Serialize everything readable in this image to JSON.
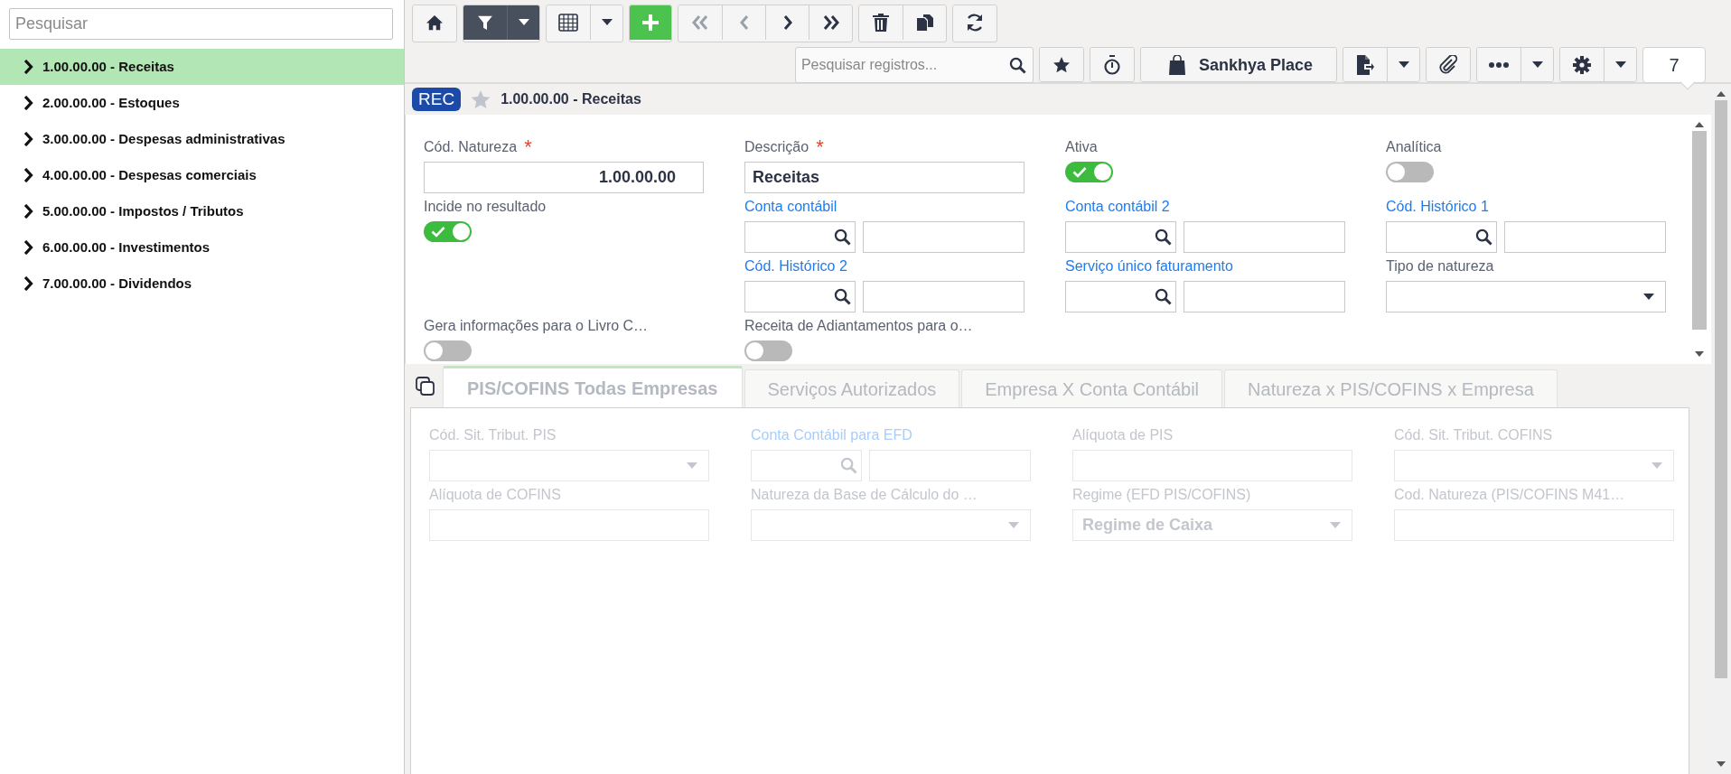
{
  "sidebar": {
    "search": {
      "placeholder": "Pesquisar"
    },
    "items": [
      {
        "label": "1.00.00.00 - Receitas",
        "selected": true
      },
      {
        "label": "2.00.00.00 - Estoques",
        "selected": false
      },
      {
        "label": "3.00.00.00 - Despesas administrativas",
        "selected": false
      },
      {
        "label": "4.00.00.00 - Despesas comerciais",
        "selected": false
      },
      {
        "label": "5.00.00.00 - Impostos / Tributos",
        "selected": false
      },
      {
        "label": "6.00.00.00 - Investimentos",
        "selected": false
      },
      {
        "label": "7.00.00.00 - Dividendos",
        "selected": false
      }
    ]
  },
  "toolbar": {
    "groups": [
      [
        {
          "kind": "home",
          "active": false,
          "disabled": false
        }
      ],
      [
        {
          "kind": "filter",
          "active": true,
          "disabled": false
        },
        {
          "kind": "caret",
          "active": true,
          "disabled": false
        }
      ],
      [
        {
          "kind": "grid",
          "active": false,
          "disabled": false
        },
        {
          "kind": "caret",
          "active": false,
          "disabled": false
        }
      ],
      [
        {
          "kind": "add",
          "active": false,
          "disabled": false
        }
      ],
      [
        {
          "kind": "first",
          "active": false,
          "disabled": true
        },
        {
          "kind": "previous",
          "active": false,
          "disabled": true
        },
        {
          "kind": "next",
          "active": false,
          "disabled": false
        },
        {
          "kind": "last",
          "active": false,
          "disabled": false
        }
      ],
      [
        {
          "kind": "delete",
          "active": false,
          "disabled": false
        },
        {
          "kind": "duplicate",
          "active": false,
          "disabled": false
        }
      ],
      [
        {
          "kind": "refresh",
          "active": false,
          "disabled": false
        }
      ]
    ],
    "search": {
      "placeholder": "Pesquisar registros..."
    },
    "actions": [
      [
        {
          "kind": "favorite"
        }
      ],
      [
        {
          "kind": "timer"
        }
      ],
      [
        {
          "kind": "place",
          "label": "Sankhya Place"
        }
      ],
      [
        {
          "kind": "export"
        },
        {
          "kind": "caret"
        }
      ],
      [
        {
          "kind": "attach"
        }
      ],
      [
        {
          "kind": "more"
        },
        {
          "kind": "caret"
        }
      ],
      [
        {
          "kind": "settings"
        },
        {
          "kind": "caret"
        }
      ]
    ],
    "count": "7"
  },
  "record": {
    "badge": "REC",
    "favorite": false,
    "title": "1.00.00.00 - Receitas"
  },
  "form": {
    "rows": [
      [
        {
          "kind": "text",
          "label": "Cód. Natureza",
          "required_mark": "*",
          "link": false,
          "value": "1.00.00.00",
          "right_aligned": true
        },
        {
          "kind": "text",
          "label": "Descrição",
          "required_mark": "*",
          "link": false,
          "value": "Receitas",
          "right_aligned": false
        },
        {
          "kind": "toggle",
          "label": "Ativa",
          "link": false,
          "on": true
        },
        {
          "kind": "toggle",
          "label": "Analítica",
          "link": false,
          "on": false
        }
      ],
      [
        {
          "kind": "toggle",
          "label": "Incide no resultado",
          "link": false,
          "on": true
        },
        {
          "kind": "lookup",
          "label": "Conta contábil",
          "link": true
        },
        {
          "kind": "lookup",
          "label": "Conta contábil 2",
          "link": true
        },
        {
          "kind": "lookup",
          "label": "Cód. Histórico 1",
          "link": true
        }
      ],
      [
        {
          "kind": "blank"
        },
        {
          "kind": "lookup",
          "label": "Cód. Histórico 2",
          "link": true
        },
        {
          "kind": "lookup",
          "label": "Serviço único faturamento",
          "link": true
        },
        {
          "kind": "select",
          "label": "Tipo de natureza",
          "link": false
        }
      ],
      [
        {
          "kind": "toggle",
          "label": "Gera informações para o Livro C…",
          "link": false,
          "on": false
        },
        {
          "kind": "toggle",
          "label": "Receita de Adiantamentos para o…",
          "link": false,
          "on": false
        }
      ]
    ]
  },
  "tabs": [
    {
      "label": "PIS/COFINS Todas Empresas",
      "selected": true
    },
    {
      "label": "Serviços Autorizados",
      "selected": false
    },
    {
      "label": "Empresa X Conta Contábil",
      "selected": false
    },
    {
      "label": "Natureza x PIS/COFINS x Empresa",
      "selected": false
    }
  ],
  "tab_panel": {
    "disabled": true,
    "rows": [
      [
        {
          "kind": "select",
          "label": "Cód. Sit. Tribut. PIS",
          "link": false
        },
        {
          "kind": "lookup",
          "label": "Conta Contábil para EFD",
          "link": true
        },
        {
          "kind": "text",
          "label": "Alíquota de PIS",
          "link": false
        },
        {
          "kind": "select",
          "label": "Cód. Sit. Tribut. COFINS",
          "link": false
        }
      ],
      [
        {
          "kind": "text",
          "label": "Alíquota de COFINS",
          "link": false
        },
        {
          "kind": "select",
          "label": "Natureza da Base de Cálculo do …",
          "link": false
        },
        {
          "kind": "select",
          "label": "Regime (EFD PIS/COFINS)",
          "link": false,
          "value": "Regime de Caixa"
        },
        {
          "kind": "text",
          "label": "Cod. Natureza (PIS/COFINS M41…",
          "link": false
        }
      ]
    ]
  }
}
